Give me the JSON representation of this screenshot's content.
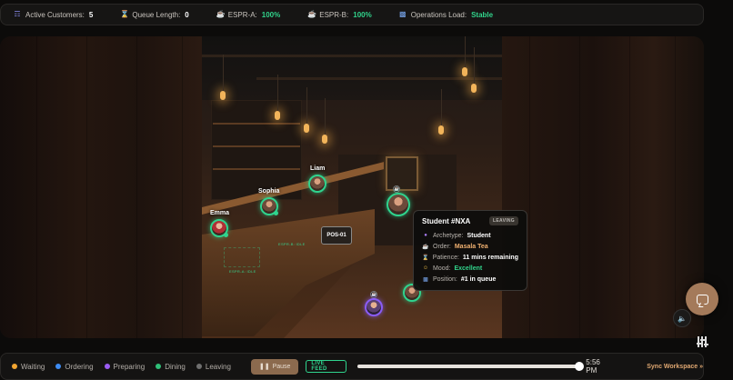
{
  "stats": {
    "active_customers_label": "Active Customers:",
    "active_customers_value": "5",
    "queue_length_label": "Queue Length:",
    "queue_length_value": "0",
    "espr_a_label": "ESPR-A:",
    "espr_a_value": "100%",
    "espr_b_label": "ESPR-B:",
    "espr_b_value": "100%",
    "ops_load_label": "Operations Load:",
    "ops_load_value": "Stable"
  },
  "scene": {
    "customers": [
      {
        "name": "Liam"
      },
      {
        "name": "Sophia"
      },
      {
        "name": "Emma"
      }
    ],
    "pos_label": "POS-01",
    "zone_idle_1": "ESPR-B: IDLE",
    "zone_idle_2": "ESPR-A: IDLE"
  },
  "tooltip": {
    "title": "Student #NXA",
    "status_badge": "LEAVING",
    "archetype_label": "Archetype:",
    "archetype_value": "Student",
    "order_label": "Order:",
    "order_value": "Masala Tea",
    "patience_label": "Patience:",
    "patience_value": "11 mins remaining",
    "mood_label": "Mood:",
    "mood_value": "Excellent",
    "position_label": "Position:",
    "position_value": "#1 in queue"
  },
  "legend": [
    {
      "label": "Waiting",
      "color": "#f2a531"
    },
    {
      "label": "Ordering",
      "color": "#3d8bf2"
    },
    {
      "label": "Preparing",
      "color": "#9a5cf2"
    },
    {
      "label": "Dining",
      "color": "#2fbf78"
    },
    {
      "label": "Leaving",
      "color": "#6f6f6f"
    }
  ],
  "controls": {
    "pause_label": "Pause",
    "live_label": "LIVE FEED",
    "timeline_progress": 1.0,
    "time": "5:56 PM",
    "sync_label": "Sync Workspace »"
  },
  "colors": {
    "accent_green": "#31d38b",
    "accent_copper": "#a47a5a"
  },
  "icons": [
    "users-icon",
    "hourglass-icon",
    "coffee-cup-icon",
    "chart-icon",
    "chat-icon",
    "volume-icon",
    "sliders-icon"
  ]
}
